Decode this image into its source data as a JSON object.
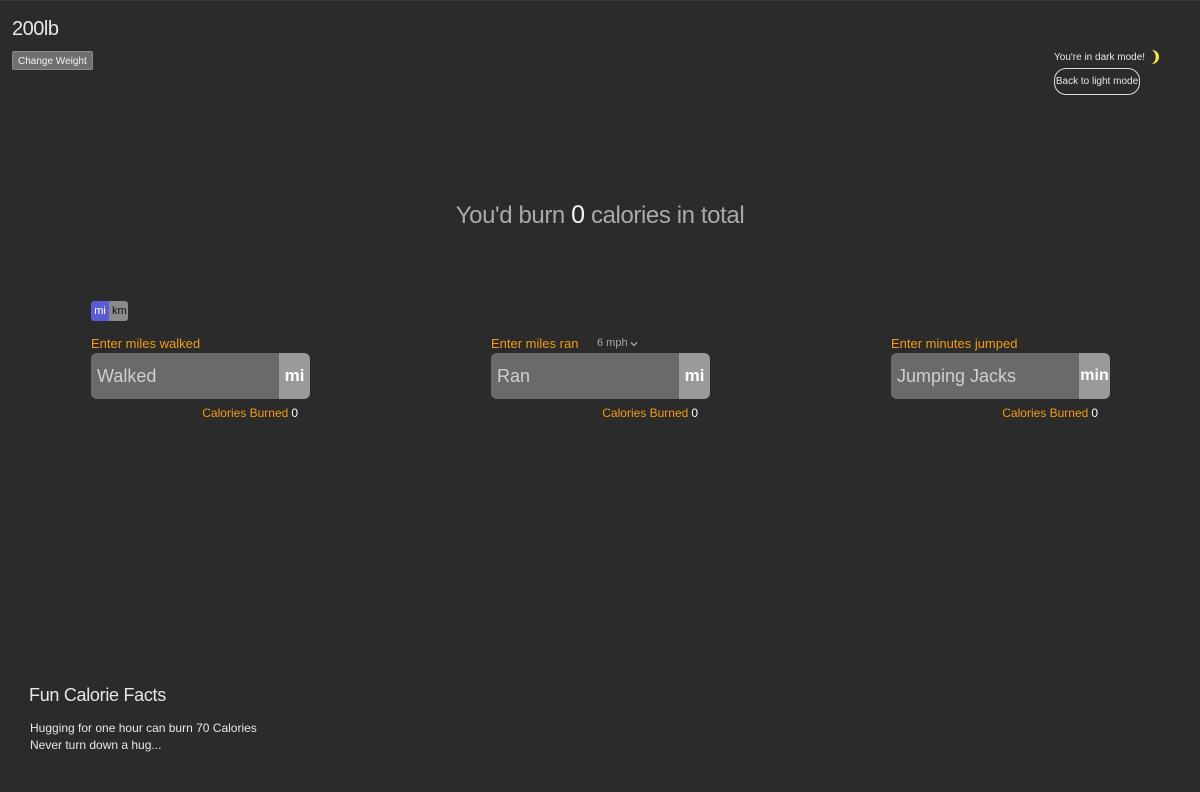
{
  "header": {
    "weight": "200lb",
    "change_weight_label": "Change Weight"
  },
  "theme": {
    "status_text": "You're in dark mode!",
    "toggle_label": "Back to light mode",
    "moon_icon": "moon-icon",
    "moon_color": "#f1e14b"
  },
  "total": {
    "prefix": "You'd burn",
    "value": "0",
    "suffix": "calories in total"
  },
  "unit_toggle": {
    "options": [
      "mi",
      "km"
    ],
    "selected": "mi",
    "selected_color": "#5b5bd6"
  },
  "activities": [
    {
      "label": "Enter miles walked",
      "placeholder": "Walked",
      "value": "",
      "unit": "mi",
      "burned_label": "Calories Burned",
      "burned_value": "0"
    },
    {
      "label": "Enter miles ran",
      "speed": "6 mph",
      "placeholder": "Ran",
      "value": "",
      "unit": "mi",
      "burned_label": "Calories Burned",
      "burned_value": "0"
    },
    {
      "label": "Enter minutes jumped",
      "placeholder": "Jumping Jacks",
      "value": "",
      "unit": "min",
      "burned_label": "Calories Burned",
      "burned_value": "0"
    }
  ],
  "facts": {
    "title": "Fun Calorie Facts",
    "lines": [
      "Hugging for one hour can burn 70 Calories",
      "Never turn down a hug..."
    ]
  },
  "colors": {
    "background": "#2b2b2b",
    "accent_orange": "#f39c12"
  }
}
